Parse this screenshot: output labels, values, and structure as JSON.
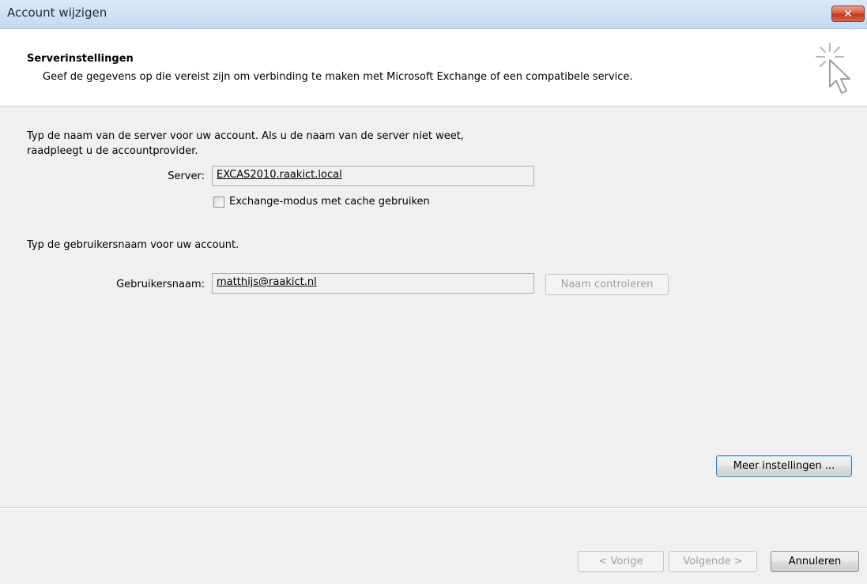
{
  "window": {
    "title": "Account wijzigen",
    "close_glyph": "✕"
  },
  "header": {
    "title": "Serverinstellingen",
    "subtitle": "Geef de gegevens op die vereist zijn om verbinding te maken met Microsoft Exchange of een compatibele service.",
    "icon": "pointer-sparkle-icon"
  },
  "server_section": {
    "intro_line1": "Typ de naam van de server voor uw account. Als u de naam van de server niet weet,",
    "intro_line2": "raadpleegt u de accountprovider.",
    "server_label": "Server:",
    "server_value": "EXCAS2010.raakict.local",
    "cache_checkbox_label": "Exchange-modus met cache gebruiken",
    "cache_checked": false
  },
  "user_section": {
    "intro": "Typ de gebruikersnaam voor uw account.",
    "username_label": "Gebruikersnaam:",
    "username_value": "matthijs@raakict.nl",
    "check_name_button": "Naam controleren"
  },
  "more_settings_button": "Meer instellingen ...",
  "footer": {
    "back_button": "< Vorige",
    "next_button": "Volgende >",
    "cancel_button": "Annuleren"
  },
  "colors": {
    "titlebar": "#c6d9f0",
    "close_button": "#c2361c",
    "background": "#f0f0f0"
  }
}
